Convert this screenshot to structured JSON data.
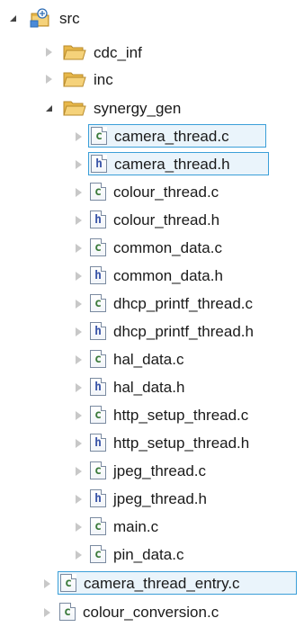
{
  "tree": {
    "root": {
      "label": "src",
      "icon": "source-folder-icon"
    },
    "folders": [
      {
        "label": "cdc_inf",
        "icon": "folder-icon"
      },
      {
        "label": "inc",
        "icon": "folder-icon"
      },
      {
        "label": "synergy_gen",
        "icon": "folder-open-icon"
      }
    ],
    "synergy_gen_files": [
      {
        "label": "camera_thread.c",
        "type": "c"
      },
      {
        "label": "camera_thread.h",
        "type": "h"
      },
      {
        "label": "colour_thread.c",
        "type": "c"
      },
      {
        "label": "colour_thread.h",
        "type": "h"
      },
      {
        "label": "common_data.c",
        "type": "c"
      },
      {
        "label": "common_data.h",
        "type": "h"
      },
      {
        "label": "dhcp_printf_thread.c",
        "type": "c"
      },
      {
        "label": "dhcp_printf_thread.h",
        "type": "h"
      },
      {
        "label": "hal_data.c",
        "type": "c"
      },
      {
        "label": "hal_data.h",
        "type": "h"
      },
      {
        "label": "http_setup_thread.c",
        "type": "c"
      },
      {
        "label": "http_setup_thread.h",
        "type": "h"
      },
      {
        "label": "jpeg_thread.c",
        "type": "c"
      },
      {
        "label": "jpeg_thread.h",
        "type": "h"
      },
      {
        "label": "main.c",
        "type": "c"
      },
      {
        "label": "pin_data.c",
        "type": "c"
      }
    ],
    "src_files": [
      {
        "label": "camera_thread_entry.c",
        "type": "c"
      },
      {
        "label": "colour_conversion.c",
        "type": "c"
      }
    ],
    "icon_glyphs": {
      "c": "c",
      "h": "h"
    },
    "colors": {
      "selection_border": "#3b9fd8",
      "selection_fill": "#eaf4fb",
      "folder": "#e8b84a"
    }
  }
}
